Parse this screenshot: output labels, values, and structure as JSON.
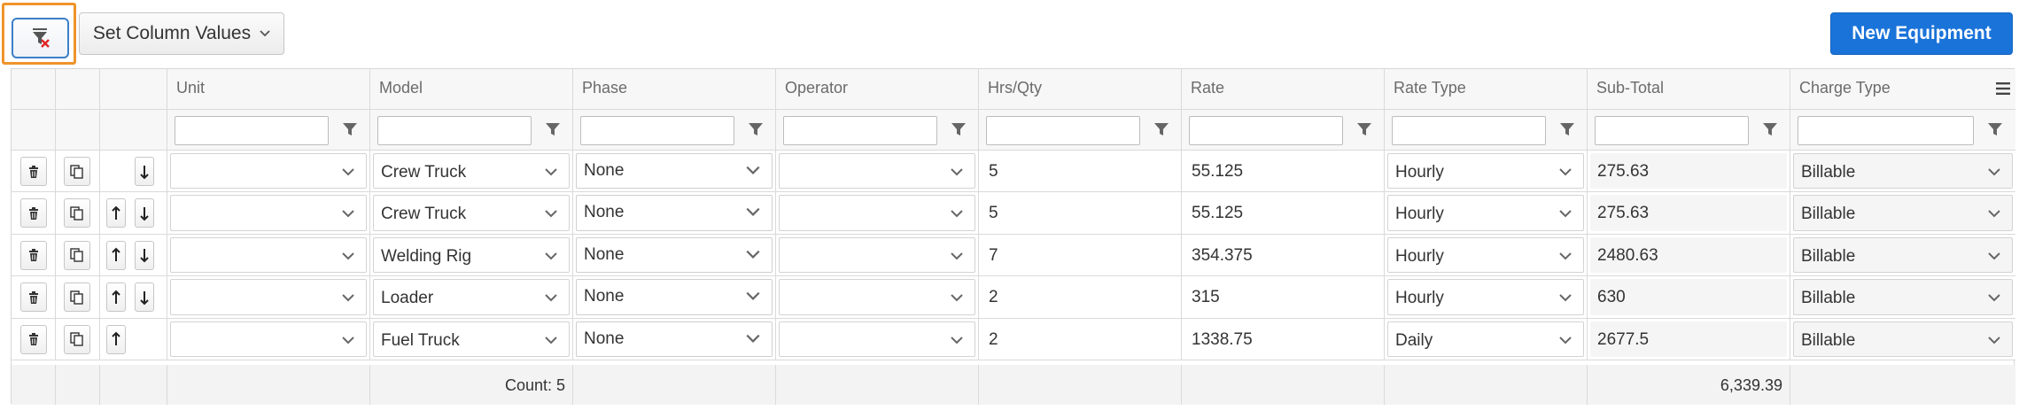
{
  "toolbar": {
    "set_column_values_label": "Set Column Values",
    "new_equipment_label": "New Equipment"
  },
  "columns": [
    {
      "key": "unit",
      "label": "Unit"
    },
    {
      "key": "model",
      "label": "Model"
    },
    {
      "key": "phase",
      "label": "Phase"
    },
    {
      "key": "operator",
      "label": "Operator"
    },
    {
      "key": "hrs_qty",
      "label": "Hrs/Qty"
    },
    {
      "key": "rate",
      "label": "Rate"
    },
    {
      "key": "rate_type",
      "label": "Rate Type"
    },
    {
      "key": "sub_total",
      "label": "Sub-Total"
    },
    {
      "key": "charge_type",
      "label": "Charge Type"
    }
  ],
  "rows": [
    {
      "unit": "",
      "model": "Crew Truck",
      "phase": "None",
      "operator": "",
      "hrs_qty": "5",
      "rate": "55.125",
      "rate_type": "Hourly",
      "sub_total": "275.63",
      "charge_type": "Billable",
      "move_up": false,
      "move_down": true
    },
    {
      "unit": "",
      "model": "Crew Truck",
      "phase": "None",
      "operator": "",
      "hrs_qty": "5",
      "rate": "55.125",
      "rate_type": "Hourly",
      "sub_total": "275.63",
      "charge_type": "Billable",
      "move_up": true,
      "move_down": true
    },
    {
      "unit": "",
      "model": "Welding Rig",
      "phase": "None",
      "operator": "",
      "hrs_qty": "7",
      "rate": "354.375",
      "rate_type": "Hourly",
      "sub_total": "2480.63",
      "charge_type": "Billable",
      "move_up": true,
      "move_down": true
    },
    {
      "unit": "",
      "model": "Loader",
      "phase": "None",
      "operator": "",
      "hrs_qty": "2",
      "rate": "315",
      "rate_type": "Hourly",
      "sub_total": "630",
      "charge_type": "Billable",
      "move_up": true,
      "move_down": true
    },
    {
      "unit": "",
      "model": "Fuel Truck",
      "phase": "None",
      "operator": "",
      "hrs_qty": "2",
      "rate": "1338.75",
      "rate_type": "Daily",
      "sub_total": "2677.5",
      "charge_type": "Billable",
      "move_up": true,
      "move_down": false
    }
  ],
  "footer": {
    "count_label": "Count: 5",
    "sub_total_sum": "6,339.39"
  },
  "icons": {
    "clear_filter": "filter-clear-icon",
    "filter": "filter-icon",
    "delete": "trash-icon",
    "copy": "copy-icon",
    "move_up": "arrow-up-icon",
    "move_down": "arrow-down-icon",
    "dropdown": "chevron-down-icon",
    "column_menu": "hamburger-menu-icon"
  },
  "colors": {
    "primary": "#1a73d9",
    "highlight_border": "#f0932b",
    "clear_x": "#e02424"
  }
}
